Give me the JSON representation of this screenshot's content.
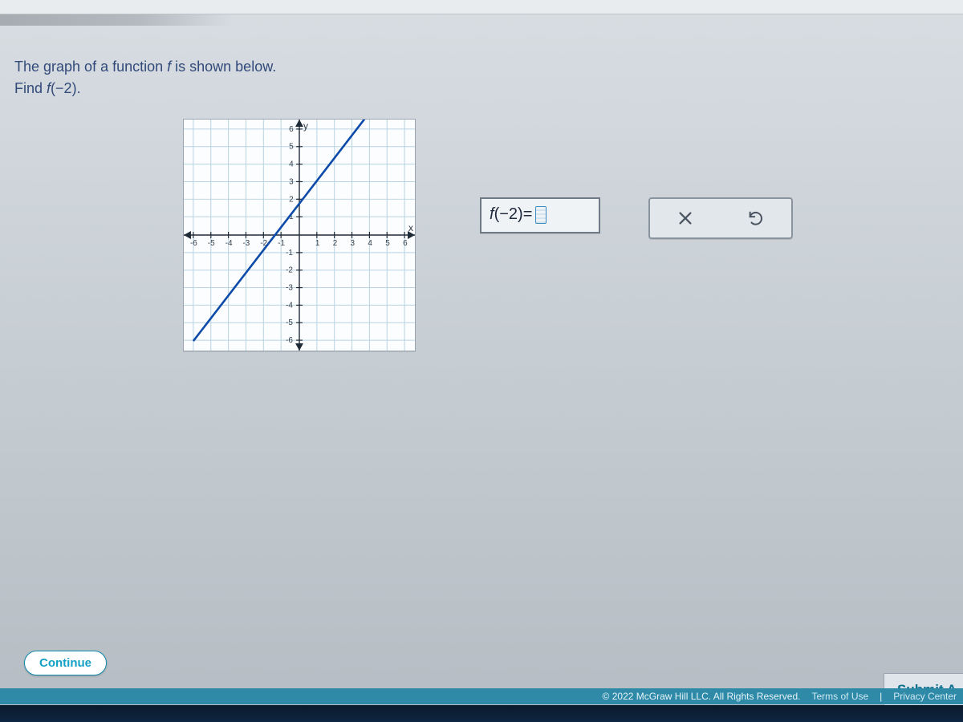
{
  "question": {
    "line1_pre": "The graph of a function ",
    "line1_fn": "f",
    "line1_post": " is shown below.",
    "line2_pre": "Find ",
    "line2_fn": "f",
    "line2_arg": "(−2)",
    "line2_post": "."
  },
  "answer": {
    "fn": "f",
    "arg": "(−2)",
    "equals": " = "
  },
  "buttons": {
    "continue": "Continue",
    "submit": "Submit A"
  },
  "footer": {
    "copyright": "© 2022 McGraw Hill LLC. All Rights Reserved.",
    "terms": "Terms of Use",
    "privacy": "Privacy Center"
  },
  "chart_data": {
    "type": "line",
    "xlabel": "x",
    "ylabel": "y",
    "xlim": [
      -6.5,
      6.5
    ],
    "ylim": [
      -6.5,
      6.5
    ],
    "xticks": [
      -6,
      -5,
      -4,
      -3,
      -2,
      -1,
      1,
      2,
      3,
      4,
      5,
      6
    ],
    "yticks": [
      -6,
      -5,
      -4,
      -3,
      -2,
      -1,
      1,
      2,
      3,
      4,
      5,
      6
    ],
    "series": [
      {
        "name": "f",
        "points": [
          [
            -6,
            -6
          ],
          [
            4,
            7
          ]
        ]
      }
    ],
    "note": "Line with slope ~1.3 and y-intercept ~1.8; passes roughly through (-2,-0.8)"
  }
}
